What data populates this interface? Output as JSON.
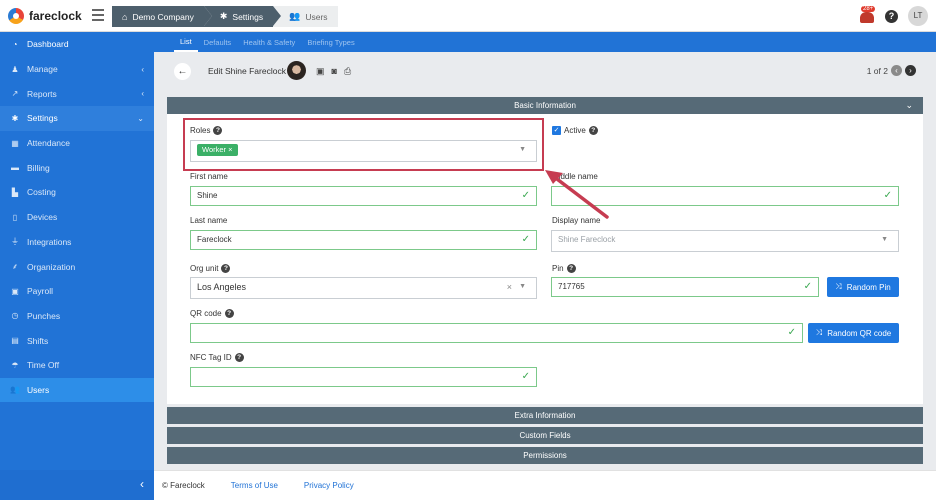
{
  "app": {
    "brand": "fareclock"
  },
  "breadcrumb": [
    {
      "label": "Demo Company",
      "icon": "home-icon"
    },
    {
      "label": "Settings",
      "icon": "gear-icon"
    },
    {
      "label": "Users",
      "icon": "users-icon"
    }
  ],
  "header": {
    "notification_count": "28+",
    "help_label": "?",
    "user_initials": "LT"
  },
  "sidebar": {
    "items": [
      {
        "label": "Dashboard",
        "icon": "dashboard-icon"
      },
      {
        "label": "Manage",
        "icon": "manage-icon",
        "caret": "‹"
      },
      {
        "label": "Reports",
        "icon": "chart-icon",
        "caret": "‹"
      },
      {
        "label": "Settings",
        "icon": "gear-icon",
        "caret": "⌄"
      },
      {
        "label": "Attendance",
        "icon": "calendar-icon"
      },
      {
        "label": "Billing",
        "icon": "credit-card-icon"
      },
      {
        "label": "Costing",
        "icon": "industry-icon"
      },
      {
        "label": "Devices",
        "icon": "tablet-icon"
      },
      {
        "label": "Integrations",
        "icon": "plug-icon"
      },
      {
        "label": "Organization",
        "icon": "sitemap-icon"
      },
      {
        "label": "Payroll",
        "icon": "money-icon"
      },
      {
        "label": "Punches",
        "icon": "clock-icon"
      },
      {
        "label": "Shifts",
        "icon": "briefcase-icon"
      },
      {
        "label": "Time Off",
        "icon": "umbrella-icon"
      },
      {
        "label": "Users",
        "icon": "users-icon"
      }
    ],
    "collapse_glyph": "‹"
  },
  "tabs": [
    "List",
    "Defaults",
    "Health & Safety",
    "Briefing Types"
  ],
  "toolbar": {
    "back_glyph": "←",
    "title": "Edit Shine Fareclock",
    "pager_text": "1 of 2",
    "prev_glyph": "‹",
    "next_glyph": "›"
  },
  "sections": {
    "basic": "Basic Information",
    "extra": "Extra Information",
    "custom": "Custom Fields",
    "permissions": "Permissions"
  },
  "form": {
    "roles_label": "Roles",
    "roles_tag": "Worker",
    "active_label": "Active",
    "first_name_label": "First name",
    "first_name_value": "Shine",
    "middle_name_label": "Middle name",
    "middle_name_value": "",
    "last_name_label": "Last name",
    "last_name_value": "Fareclock",
    "display_name_label": "Display name",
    "display_name_placeholder": "Shine Fareclock",
    "org_unit_label": "Org unit",
    "org_unit_value": "Los Angeles",
    "pin_label": "Pin",
    "pin_value": "717765",
    "random_pin_label": "Random Pin",
    "qr_label": "QR code",
    "qr_value": "",
    "random_qr_label": "Random QR code",
    "nfc_label": "NFC Tag ID",
    "nfc_value": ""
  },
  "footer": {
    "copyright": "© Fareclock",
    "terms": "Terms of Use",
    "privacy": "Privacy Policy"
  },
  "colors": {
    "primary": "#2173d6",
    "section_bar": "#566a77",
    "highlight": "#c63c51",
    "valid": "#3aa851",
    "tag": "#3bb067"
  }
}
